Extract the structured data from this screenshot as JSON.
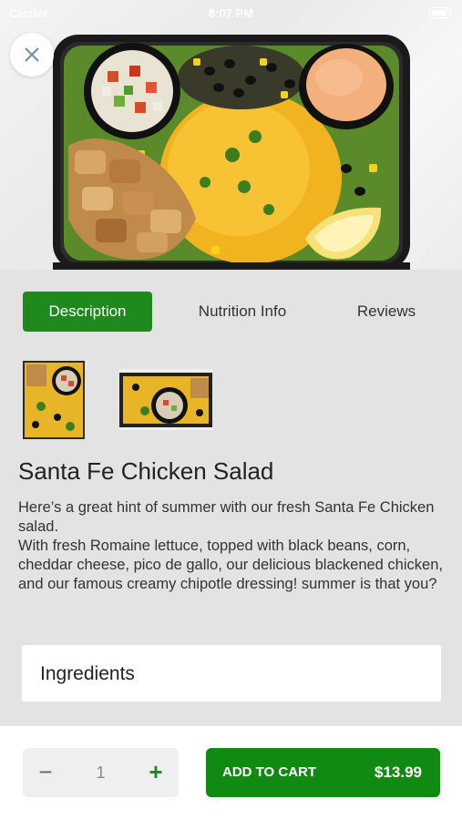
{
  "status_bar": {
    "carrier": "Carrier",
    "time": "8:07 PM"
  },
  "hero": {
    "image": "santa-fe-chicken-salad-photo",
    "close_icon": "close-icon"
  },
  "tabs": [
    {
      "label": "Description",
      "active": true
    },
    {
      "label": "Nutrition Info",
      "active": false
    },
    {
      "label": "Reviews",
      "active": false
    }
  ],
  "product": {
    "title": "Santa Fe Chicken Salad",
    "description_lines": [
      "Here’s a great hint of summer with our fresh Santa Fe Chicken salad.",
      "With fresh Romaine lettuce, topped with black beans, corn, cheddar cheese, pico de gallo, our delicious blackened chicken, and our famous creamy chipotle dressing! summer is that you?"
    ]
  },
  "ingredients": {
    "title": "Ingredients"
  },
  "cart": {
    "minus": "−",
    "quantity": "1",
    "plus": "+",
    "add_label": "ADD TO CART",
    "price": "$13.99"
  },
  "colors": {
    "accent": "#1e8a1e",
    "button": "#118a11",
    "background": "#e3e3e3"
  }
}
